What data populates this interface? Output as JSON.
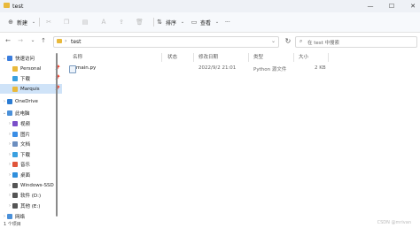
{
  "window": {
    "title": "test",
    "minimize": "—",
    "maximize": "☐",
    "close": "✕"
  },
  "toolbar": {
    "new_label": "新建",
    "sort_label": "排序",
    "view_label": "查看",
    "more": "···"
  },
  "address": {
    "back": "←",
    "forward": "→",
    "dropdown": "⌄",
    "up": "↑",
    "path": "test",
    "refresh": "↻",
    "search_placeholder": "在 test 中搜索"
  },
  "sidebar": {
    "items": [
      {
        "label": "快速访问",
        "chevron": "⌄",
        "color": "#3b7ddd",
        "pinned": false
      },
      {
        "label": "Personal",
        "chevron": "",
        "color": "#e9b93b",
        "pinned": true
      },
      {
        "label": "下载",
        "chevron": "",
        "color": "#3aa0e0",
        "pinned": true
      },
      {
        "label": "Marquis",
        "chevron": "",
        "color": "#e9b93b",
        "pinned": true
      },
      {
        "label": "OneDrive",
        "chevron": "›",
        "color": "#2b7cd3",
        "pinned": false
      },
      {
        "label": "此电脑",
        "chevron": "⌄",
        "color": "#4a90d9",
        "pinned": false
      },
      {
        "label": "视频",
        "chevron": "›",
        "color": "#7b4fc9",
        "pinned": false
      },
      {
        "label": "图片",
        "chevron": "›",
        "color": "#3a8ee6",
        "pinned": false
      },
      {
        "label": "文档",
        "chevron": "›",
        "color": "#6c8ebf",
        "pinned": false
      },
      {
        "label": "下载",
        "chevron": "›",
        "color": "#3aa0e0",
        "pinned": false
      },
      {
        "label": "音乐",
        "chevron": "›",
        "color": "#e0553a",
        "pinned": false
      },
      {
        "label": "桌面",
        "chevron": "›",
        "color": "#2f8fdc",
        "pinned": false
      },
      {
        "label": "Windows-SSD (",
        "chevron": "›",
        "color": "#555555",
        "pinned": false
      },
      {
        "label": "软件 (D:)",
        "chevron": "›",
        "color": "#555555",
        "pinned": false
      },
      {
        "label": "其他 (E:)",
        "chevron": "›",
        "color": "#555555",
        "pinned": false
      },
      {
        "label": "网络",
        "chevron": "›",
        "color": "#4a90d9",
        "pinned": false
      }
    ]
  },
  "columns": [
    "名称",
    "状态",
    "修改日期",
    "类型",
    "大小"
  ],
  "files": [
    {
      "name": "main.py",
      "date": "2022/9/2 21:01",
      "type": "Python 源文件",
      "size": "2 KB"
    }
  ],
  "status": {
    "count": "1 个项目",
    "watermark": "CSDN @mrivan"
  }
}
